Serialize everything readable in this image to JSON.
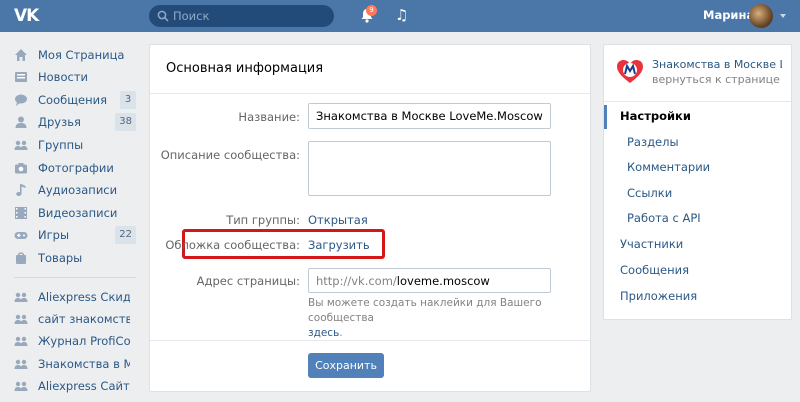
{
  "header": {
    "logo_text": "VK",
    "search_placeholder": "Поиск",
    "notifications_count": "9",
    "user_name": "Марина"
  },
  "sidebar": {
    "items": [
      {
        "label": "Моя Страница",
        "icon": "home-icon"
      },
      {
        "label": "Новости",
        "icon": "news-icon"
      },
      {
        "label": "Сообщения",
        "icon": "messages-icon",
        "count": "3"
      },
      {
        "label": "Друзья",
        "icon": "friends-icon",
        "count": "38"
      },
      {
        "label": "Группы",
        "icon": "groups-icon"
      },
      {
        "label": "Фотографии",
        "icon": "camera-icon"
      },
      {
        "label": "Аудиозаписи",
        "icon": "music-icon"
      },
      {
        "label": "Видеозаписи",
        "icon": "video-icon"
      },
      {
        "label": "Игры",
        "icon": "gamepad-icon",
        "count": "22"
      },
      {
        "label": "Товары",
        "icon": "bag-icon"
      }
    ],
    "groups": [
      {
        "label": "Aliexpress Скид..."
      },
      {
        "label": "сайт знакомств..."
      },
      {
        "label": "Журнал ProfiCom..."
      },
      {
        "label": "Знакомства в Мо..."
      },
      {
        "label": "Aliexpress Сайт..."
      }
    ]
  },
  "main": {
    "title": "Основная информация",
    "name_label": "Название:",
    "name_value": "Знакомства в Москве LoveMe.Moscow",
    "description_label": "Описание сообщества:",
    "description_value": "",
    "group_type_label": "Тип группы:",
    "group_type_value": "Открытая",
    "cover_label": "Обложка сообщества:",
    "cover_action": "Загрузить",
    "address_label": "Адрес страницы:",
    "address_prefix": "http://vk.com/",
    "address_value": "loveme.moscow",
    "hint_text": "Вы можете создать наклейки для Вашего сообщества",
    "hint_link": "здесь",
    "save_label": "Сохранить"
  },
  "right_panel": {
    "group_name": "Знакомства в Москве Lo...",
    "back_label": "вернуться к странице",
    "menu": {
      "settings": "Настройки",
      "sections": "Разделы",
      "comments": "Комментарии",
      "links": "Ссылки",
      "api": "Работа с API",
      "members": "Участники",
      "messages": "Сообщения",
      "apps": "Приложения"
    }
  },
  "colors": {
    "header_bg": "#4a76a8",
    "link": "#2a5885",
    "highlight_border": "#d4161b",
    "button": "#5181b8"
  }
}
